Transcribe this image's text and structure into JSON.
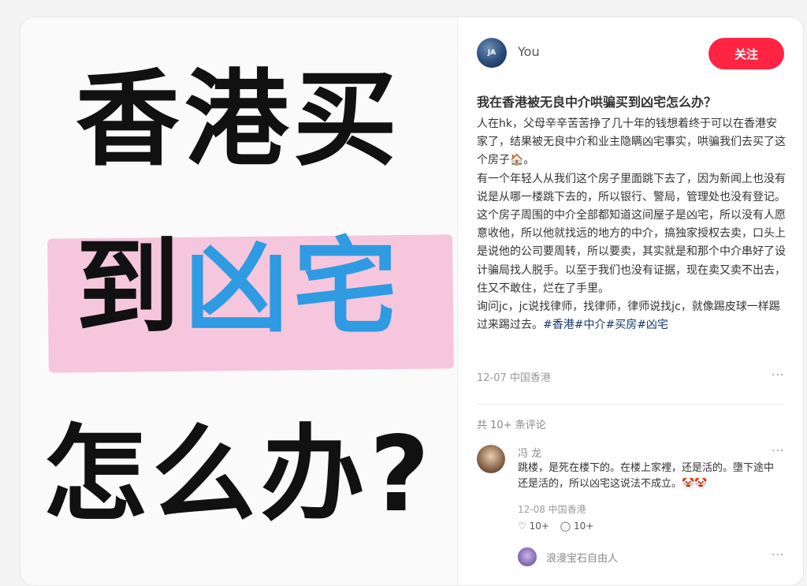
{
  "cover": {
    "line1": "香港买",
    "line2_a": "到",
    "line2_b": "凶宅",
    "line3": "怎么办?"
  },
  "author": {
    "avatar_text": "JA",
    "name": "You",
    "follow_label": "关注"
  },
  "post": {
    "title": "我在香港被无良中介哄骗买到凶宅怎么办？",
    "paragraphs": [
      "人在hk，父母辛辛苦苦挣了几十年的钱想着终于可以在香港安家了，结果被无良中介和业主隐瞒凶宅事实，哄骗我们去买了这个房子🏠。",
      "有一个年轻人从我们这个房子里面跳下去了，因为新闻上也没有说是从哪一楼跳下去的，所以银行、警局，管理处也没有登记。这个房子周围的中介全部都知道这间屋子是凶宅，所以没有人愿意收他，所以他就找远的地方的中介，搞独家授权去卖，口头上是说他的公司要周转，所以要卖，其实就是和那个中介串好了设计骗局找人脱手。以至于我们也没有证据，现在卖又卖不出去，住又不敢住，烂在了手里。"
    ],
    "last_paragraph_text": "询问jc，jc说找律师，找律师，律师说找jc，就像踢皮球一样踢过来踢过去。",
    "tags": [
      "#香港",
      "#中介",
      "#买房",
      "#凶宅"
    ],
    "meta": "12-07 中国香港",
    "more": "···"
  },
  "comments": {
    "count_label": "共 10+ 条评论",
    "items": [
      {
        "name": "冯 龙",
        "text": "跳楼，是死在楼下的。在楼上家裡，还是活的。墮下途中还是活的，所以凶宅这说法不成立。🤡🤡",
        "meta": "12-08 中国香港",
        "likes": "♡ 10+",
        "replies": "◯ 10+",
        "more": "···"
      }
    ],
    "reply": {
      "name": "浪漫宝石自由人",
      "more": "···"
    }
  }
}
